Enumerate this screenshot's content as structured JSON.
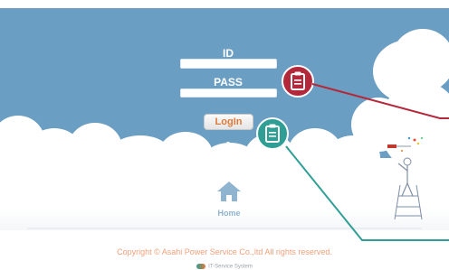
{
  "login": {
    "id_label": "ID",
    "pass_label": "PASS",
    "login_button": "LogIn"
  },
  "home": {
    "label": "Home"
  },
  "footer": {
    "copyright": "Copyright © Asahi Power Service Co.,ltd All rights reserved.",
    "system": "IT-Service System"
  },
  "icons": {
    "plus": "plus-icon",
    "home": "home-icon",
    "clipboard": "clipboard-icon"
  },
  "colors": {
    "sky": "#6b9ec3",
    "clipboard_red": "#b4283b",
    "clipboard_teal": "#2f9e95",
    "login_text": "#e07a3a",
    "copyright_text": "#f0a07a"
  }
}
